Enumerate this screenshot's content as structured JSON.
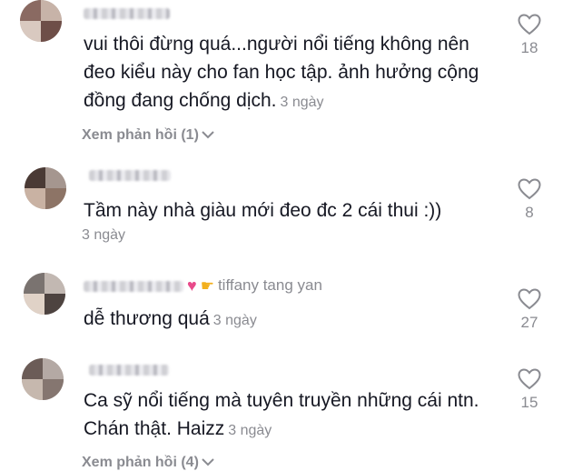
{
  "comments": [
    {
      "username": "",
      "text": "vui thôi đừng quá...người nổi tiếng không nên đeo kiểu này cho fan học tập. ảnh hưởng cộng đồng đang chống dịch.",
      "time": "3 ngày",
      "likes": "18",
      "replies_label": "Xem phản hồi (1)"
    },
    {
      "username": "",
      "text": "Tầm này nhà giàu mới đeo đc 2 cái thui :))",
      "time": "3 ngày",
      "likes": "8"
    },
    {
      "username": "",
      "mention": "tiffany tang yan",
      "text": "dễ thương quá",
      "time": "3 ngày",
      "likes": "27"
    },
    {
      "username": "",
      "text": "Ca sỹ nổi tiếng mà tuyên truyền những cái ntn. Chán thật. Haizz",
      "time": "3 ngày",
      "likes": "15",
      "replies_label": "Xem phản hồi (4)"
    }
  ],
  "colors": {
    "text": "#161823",
    "muted": "#8a8b91",
    "heart_emoji": "#e84a8a",
    "hand_emoji": "#f2b01e"
  },
  "icons": {
    "like": "heart-outline-icon",
    "expand": "chevron-down-icon",
    "emoji_1": "pink-heart-emoji",
    "emoji_2": "pointing-hand-emoji"
  }
}
